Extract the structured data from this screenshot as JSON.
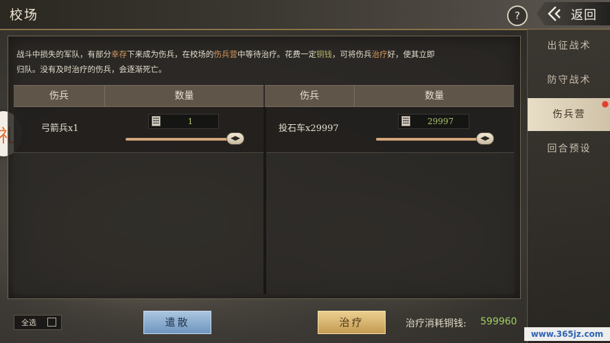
{
  "title": "校场",
  "help_label": "?",
  "back_label": "返回",
  "description": {
    "part1": "战斗中损失的军队，有部分",
    "hl1": "幸存",
    "part2": "下来成为伤兵，在校场的",
    "hl2": "伤兵营",
    "part3": "中等待治疗。花费一定",
    "hl3": "铜钱",
    "part4": "，可将伤兵",
    "hl4": "治疗",
    "part5": "好，使其立即",
    "line2": "归队。没有及时治疗的伤兵，会逐渐死亡。"
  },
  "table": {
    "col_unit": "伤兵",
    "col_qty": "数量",
    "left": {
      "unit": "弓箭兵x1",
      "qty": "1"
    },
    "right": {
      "unit": "投石车x29997",
      "qty": "29997"
    }
  },
  "sidebar": {
    "tabs": [
      "出征战术",
      "防守战术",
      "伤兵营",
      "回合预设"
    ],
    "active": "伤兵营"
  },
  "bottom": {
    "select_all": "全选",
    "dismiss": "遣散",
    "heal": "治疗",
    "cost_label": "治疗消耗铜钱:",
    "cost_value": "599960"
  },
  "watermark": "www.365jz.com",
  "left_tab_glyph": "礼",
  "colors": {
    "accent_gold": "#c49b52",
    "accent_blue": "#6f95be",
    "cost_green": "#9fcf60",
    "highlight_orange": "#d89a5e"
  }
}
